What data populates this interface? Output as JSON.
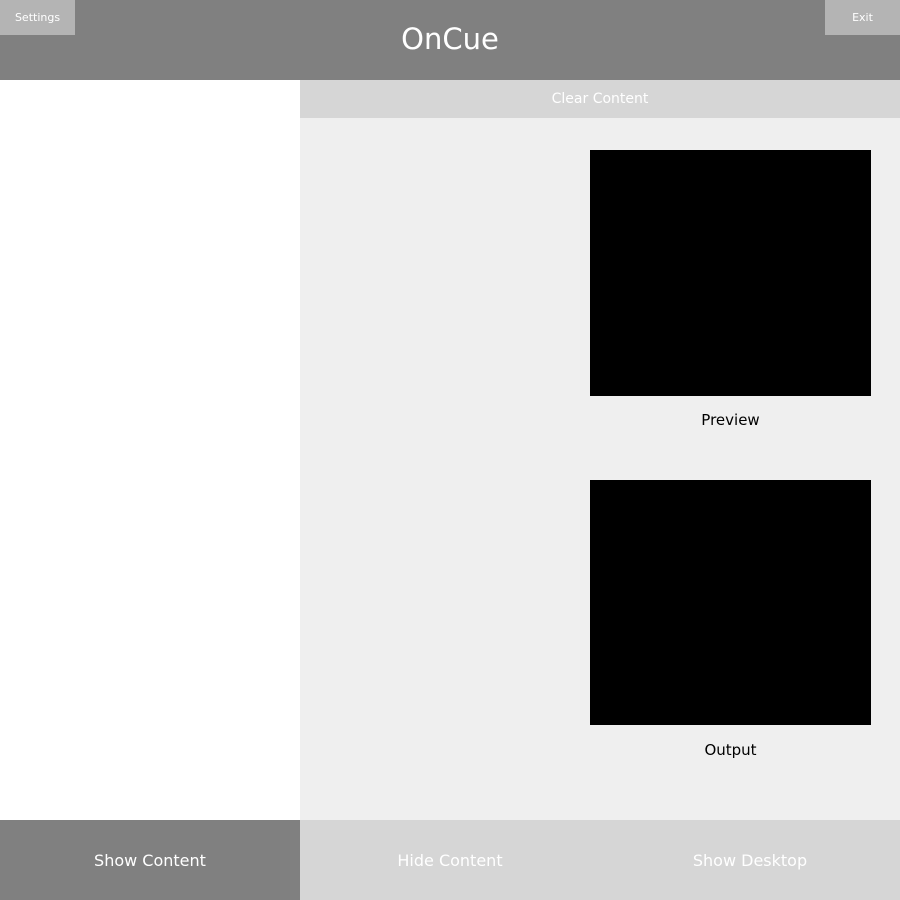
{
  "header": {
    "title": "OnCue",
    "settings_label": "Settings",
    "exit_label": "Exit"
  },
  "main": {
    "clear_label": "Clear Content",
    "preview_label": "Preview",
    "output_label": "Output"
  },
  "footer": {
    "show_content": "Show Content",
    "hide_content": "Hide Content",
    "show_desktop": "Show Desktop"
  },
  "colors": {
    "header": "#808080",
    "button_light": "#b4b4b4",
    "panel": "#efefef",
    "bar": "#d6d6d6"
  }
}
